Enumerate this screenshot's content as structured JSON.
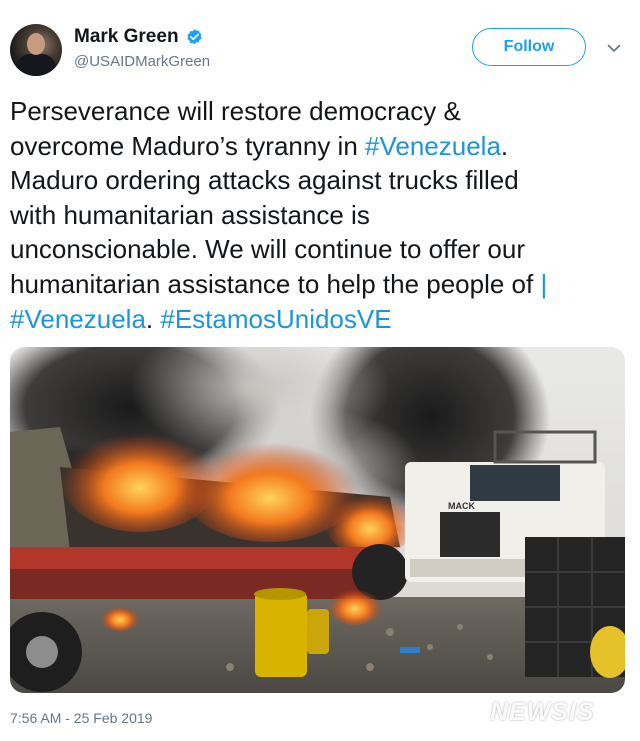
{
  "tweet": {
    "author_name": "Mark Green",
    "author_handle": "@USAIDMarkGreen",
    "follow_label": "Follow",
    "text_lines": [
      [
        {
          "t": "Perseverance will restore democracy &",
          "tag": false
        }
      ],
      [
        {
          "t": "overcome Maduro’s tyranny in ",
          "tag": false
        },
        {
          "t": "#Venezuela",
          "tag": true
        },
        {
          "t": ".",
          "tag": false
        }
      ],
      [
        {
          "t": "Maduro ordering attacks against trucks filled",
          "tag": false
        }
      ],
      [
        {
          "t": "with humanitarian assistance is",
          "tag": false
        }
      ],
      [
        {
          "t": "unconscionable. We will continue to offer our",
          "tag": false
        }
      ],
      [
        {
          "t": "humanitarian assistance to help the people of ",
          "tag": false
        },
        {
          "t": "|",
          "tag": true
        }
      ],
      [
        {
          "t": "#Venezuela",
          "tag": true
        },
        {
          "t": ". ",
          "tag": false
        },
        {
          "t": "#EstamosUnidosVE",
          "tag": true
        }
      ]
    ],
    "timestamp": "7:56 AM - 25 Feb 2019"
  },
  "media": {
    "truck_brand": "MACK"
  },
  "watermark": "NEWSIS",
  "colors": {
    "link": "#1b95e0",
    "follow": "#1da1f2",
    "verified": "#1da1f2",
    "muted": "#657786"
  },
  "icons": [
    "verified-badge-icon",
    "chevron-down-icon"
  ]
}
